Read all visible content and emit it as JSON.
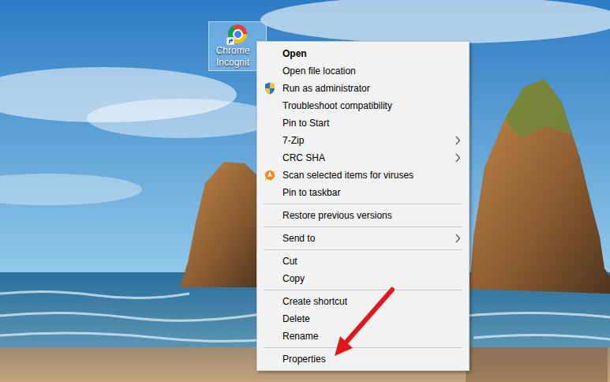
{
  "desktop": {
    "icons": [
      {
        "label_lines": [
          "Chrome",
          "Incognit"
        ],
        "selected": true
      }
    ]
  },
  "context_menu": {
    "groups": [
      [
        {
          "label": "Open",
          "default": true,
          "submenu": false,
          "kind": "plain"
        },
        {
          "label": "Open file location",
          "default": false,
          "submenu": false,
          "kind": "plain"
        },
        {
          "label": "Run as administrator",
          "default": false,
          "submenu": false,
          "kind": "shield"
        },
        {
          "label": "Troubleshoot compatibility",
          "default": false,
          "submenu": false,
          "kind": "plain"
        },
        {
          "label": "Pin to Start",
          "default": false,
          "submenu": false,
          "kind": "plain"
        },
        {
          "label": "7-Zip",
          "default": false,
          "submenu": true,
          "kind": "plain"
        },
        {
          "label": "CRC SHA",
          "default": false,
          "submenu": true,
          "kind": "plain"
        },
        {
          "label": "Scan selected items for viruses",
          "default": false,
          "submenu": false,
          "kind": "scan"
        },
        {
          "label": "Pin to taskbar",
          "default": false,
          "submenu": false,
          "kind": "plain"
        }
      ],
      [
        {
          "label": "Restore previous versions",
          "default": false,
          "submenu": false,
          "kind": "plain"
        }
      ],
      [
        {
          "label": "Send to",
          "default": false,
          "submenu": true,
          "kind": "plain"
        }
      ],
      [
        {
          "label": "Cut",
          "default": false,
          "submenu": false,
          "kind": "plain"
        },
        {
          "label": "Copy",
          "default": false,
          "submenu": false,
          "kind": "plain"
        }
      ],
      [
        {
          "label": "Create shortcut",
          "default": false,
          "submenu": false,
          "kind": "plain"
        },
        {
          "label": "Delete",
          "default": false,
          "submenu": false,
          "kind": "plain"
        },
        {
          "label": "Rename",
          "default": false,
          "submenu": false,
          "kind": "plain"
        }
      ],
      [
        {
          "label": "Properties",
          "default": false,
          "submenu": false,
          "kind": "plain"
        }
      ]
    ]
  }
}
